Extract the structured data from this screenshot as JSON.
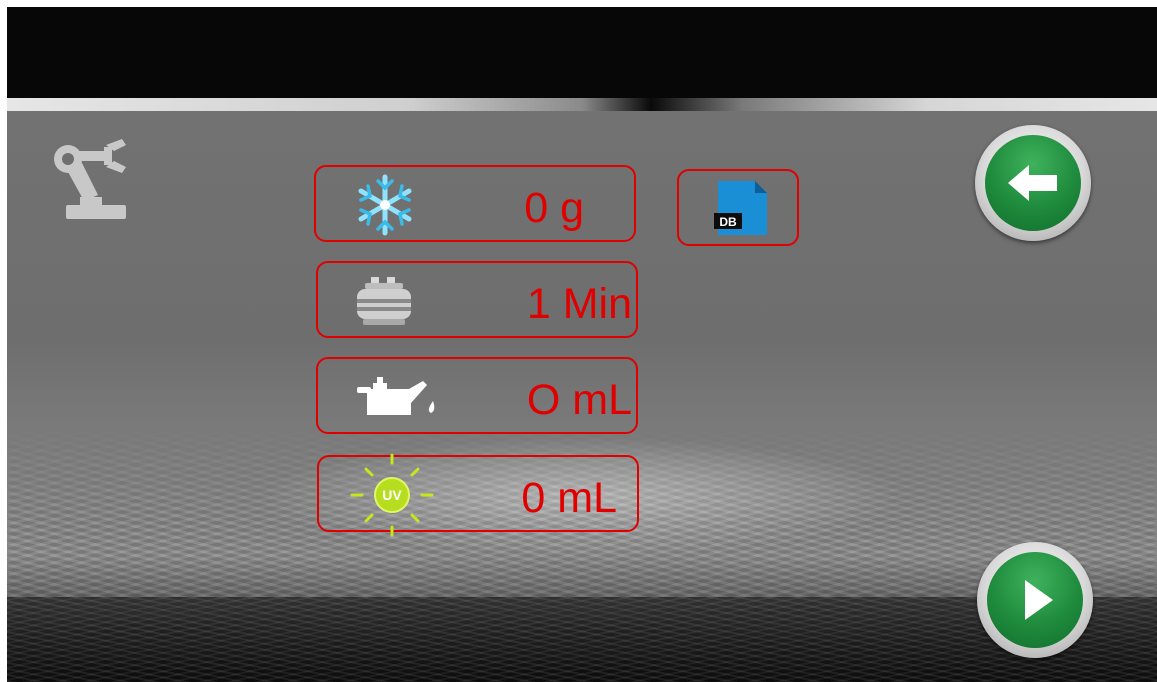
{
  "window": {
    "background": "#6f6f6f",
    "topbar": "#070707"
  },
  "header": {
    "robot_icon": "robot-arm-icon"
  },
  "rows": [
    {
      "icon": "snowflake-icon",
      "value": "0 g"
    },
    {
      "icon": "vacuum-pump-icon",
      "value": "1 Min"
    },
    {
      "icon": "oil-can-icon",
      "value": "O mL"
    },
    {
      "icon": "uv-light-icon",
      "value": "0 mL",
      "icon_text": "UV"
    }
  ],
  "db_button": {
    "icon": "database-file-icon",
    "label": "DB"
  },
  "nav": {
    "back_icon": "arrow-left-icon",
    "play_icon": "play-icon"
  },
  "colors": {
    "accent_red": "#e00000",
    "button_green": "#1e8a3c",
    "db_blue": "#1a8fd6"
  }
}
